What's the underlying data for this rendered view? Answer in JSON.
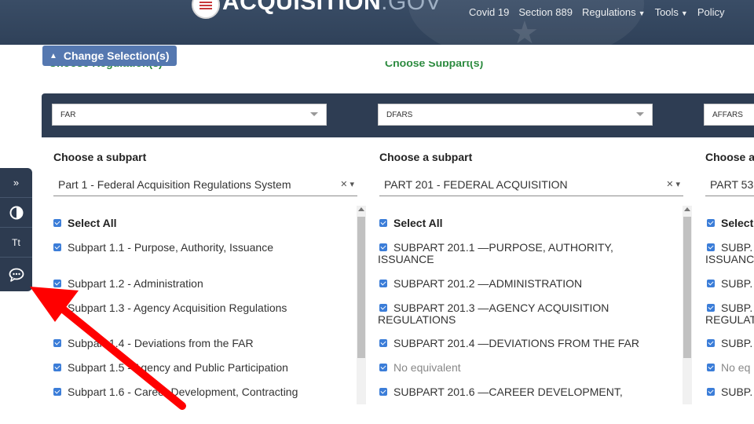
{
  "nav": {
    "logo_main": "ACQUISITION",
    "logo_suffix": ".GOV",
    "links": [
      {
        "label": "Covid 19",
        "dropdown": false
      },
      {
        "label": "Section 889",
        "dropdown": false
      },
      {
        "label": "Regulations",
        "dropdown": true
      },
      {
        "label": "Tools",
        "dropdown": true
      },
      {
        "label": "Policy",
        "dropdown": false
      }
    ]
  },
  "change_selection": {
    "label": "Change Selection(s)",
    "icon": "chevron-up-icon"
  },
  "clipped_labels": [
    "Choose Regulation(s)",
    "Choose Subpart(s)"
  ],
  "columns": [
    {
      "regulation": "FAR",
      "title": "Choose a subpart",
      "part": "Part 1 - Federal Acquisition Regulations System",
      "items": [
        {
          "label": "Select All",
          "bold": true,
          "checked": true
        },
        {
          "label": "Subpart 1.1 - Purpose, Authority, Issuance",
          "checked": true
        },
        {
          "label": "Subpart 1.2 - Administration",
          "checked": true
        },
        {
          "label": "Subpart 1.3 - Agency Acquisition Regulations",
          "checked": true
        },
        {
          "label": "Subpart 1.4 - Deviations from the FAR",
          "checked": true
        },
        {
          "label": "Subpart 1.5 - Agency and Public Participation",
          "checked": true
        },
        {
          "label": "Subpart 1.6 - Career Development, Contracting",
          "checked": true
        }
      ]
    },
    {
      "regulation": "DFARS",
      "title": "Choose a subpart",
      "part": "PART 201 - FEDERAL ACQUISITION",
      "items": [
        {
          "label": "Select All",
          "bold": true,
          "checked": true
        },
        {
          "label": "SUBPART 201.1 —PURPOSE, AUTHORITY,",
          "label2": "ISSUANCE",
          "checked": true
        },
        {
          "label": "SUBPART 201.2 —ADMINISTRATION",
          "checked": true
        },
        {
          "label": "SUBPART 201.3 —AGENCY ACQUISITION",
          "label2": "REGULATIONS",
          "checked": true
        },
        {
          "label": "SUBPART 201.4 —DEVIATIONS FROM THE FAR",
          "checked": true
        },
        {
          "label": "No equivalent",
          "gray": true,
          "checked": true
        },
        {
          "label": "SUBPART 201.6 —CAREER DEVELOPMENT,",
          "checked": true
        }
      ]
    },
    {
      "regulation": "AFFARS",
      "title": "Choose a",
      "part": "PART 53",
      "items": [
        {
          "label": "Select",
          "bold": true,
          "checked": true
        },
        {
          "label": "SUBP.",
          "label2": "ISSUANC",
          "checked": true
        },
        {
          "label": "SUBP.",
          "checked": true
        },
        {
          "label": "SUBP.",
          "label2": "REGULAT",
          "checked": true
        },
        {
          "label": "SUBP.",
          "checked": true
        },
        {
          "label": "No eq",
          "gray": true,
          "checked": true
        },
        {
          "label": "SUBP.",
          "checked": true
        }
      ]
    }
  ],
  "a11y_toolbar": {
    "expand_label": "»",
    "contrast_icon": "contrast-icon",
    "text_size_label": "Tt",
    "feedback_icon": "chat-bubble-icon"
  },
  "colors": {
    "nav_bg": "#2f4159",
    "panel_header_bg": "#2e3d53",
    "button_bg": "#5578b0",
    "checkbox": "#3b7dd8",
    "annotation_arrow": "#ff0000"
  }
}
